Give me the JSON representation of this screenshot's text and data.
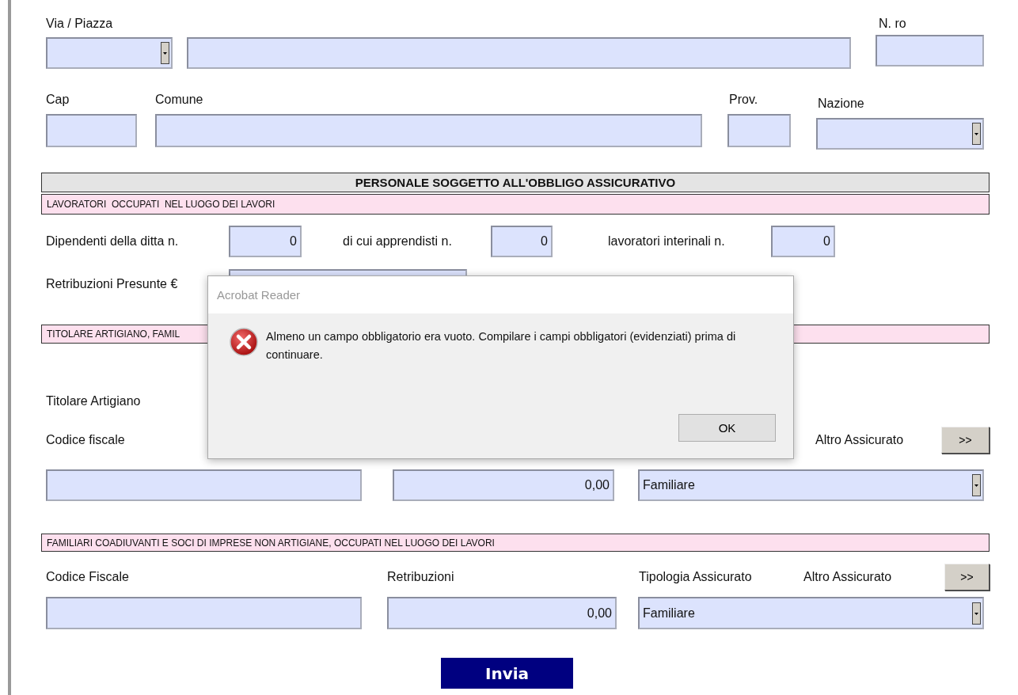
{
  "address": {
    "street_label": "Via / Piazza",
    "number_label": "N. ro",
    "cap_label": "Cap",
    "comune_label": "Comune",
    "prov_label": "Prov.",
    "nazione_label": "Nazione"
  },
  "section_title": "PERSONALE SOGGETTO ALL'OBBLIGO ASSICURATIVO",
  "workers": {
    "banner": "LAVORATORI  OCCUPATI  NEL LUOGO DEI LAVORI",
    "counts": [
      {
        "label": "Dipendenti della ditta n.",
        "value": "0"
      },
      {
        "label": "di cui apprendisti n.",
        "value": "0"
      },
      {
        "label": "lavoratori interinali n.",
        "value": "0"
      }
    ],
    "wages_label": "Retribuzioni Presunte €"
  },
  "artisan": {
    "banner": "TITOLARE ARTIGIANO, FAMIL",
    "title_label": "Titolare Artigiano",
    "tax_code_label": "Codice fiscale",
    "other_label": "Altro Assicurato",
    "other_button": ">>",
    "wages_value": "0,00",
    "type_value": "Familiare"
  },
  "family": {
    "banner": "FAMILIARI COADIUVANTI E SOCI DI IMPRESE NON ARTIGIANE, OCCUPATI NEL LUOGO DEI LAVORI",
    "tax_code_label": "Codice Fiscale",
    "wages_label": "Retribuzioni",
    "type_label": "Tipologia Assicurato",
    "other_label": "Altro Assicurato",
    "other_button": ">>",
    "wages_value": "0,00",
    "type_value": "Familiare"
  },
  "submit": "Invia",
  "dialog": {
    "title": "Acrobat Reader",
    "message": "Almeno un campo obbligatorio era vuoto. Compilare i campi obbligatori (evidenziati) prima di continuare.",
    "button": "OK"
  }
}
